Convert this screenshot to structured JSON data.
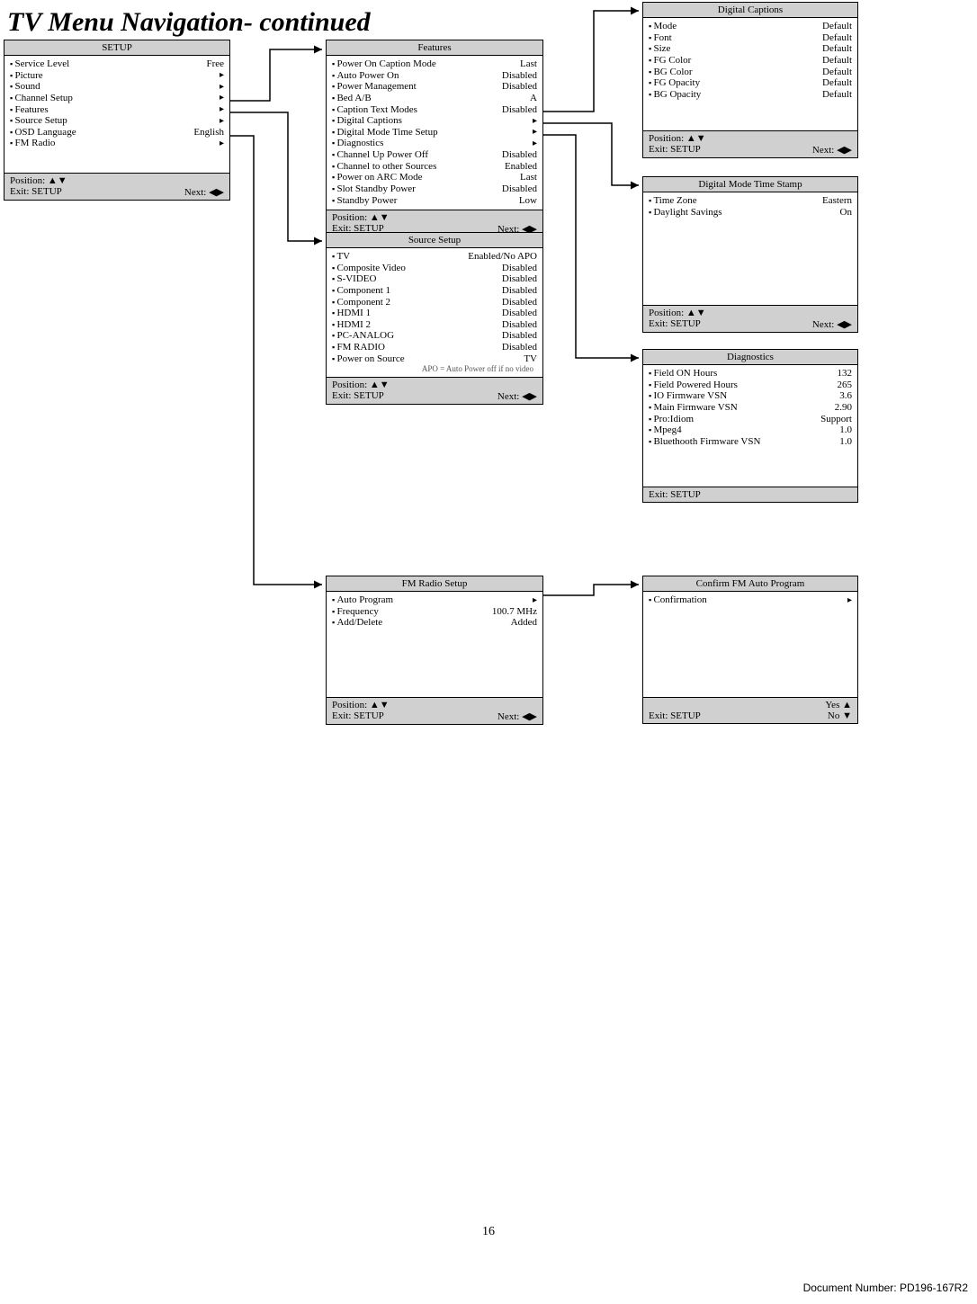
{
  "page": {
    "title": "TV Menu Navigation- continued",
    "number": "16",
    "docnum": "Document Number: PD196-167R2"
  },
  "footer_labels": {
    "position": "Position: ▲▼",
    "exit": "Exit: SETUP",
    "next": "Next: ◀▶",
    "yes": "Yes ▲",
    "no": "No ▼"
  },
  "setup": {
    "title": "SETUP",
    "rows": [
      {
        "label": "Service Level",
        "value": "Free"
      },
      {
        "label": "Picture",
        "value": "▸"
      },
      {
        "label": "Sound",
        "value": "▸"
      },
      {
        "label": "Channel Setup",
        "value": "▸"
      },
      {
        "label": "Features",
        "value": "▸"
      },
      {
        "label": "Source Setup",
        "value": "▸"
      },
      {
        "label": "OSD Language",
        "value": "English"
      },
      {
        "label": "FM Radio",
        "value": "▸"
      }
    ]
  },
  "features": {
    "title": "Features",
    "rows": [
      {
        "label": "Power On Caption Mode",
        "value": "Last"
      },
      {
        "label": "Auto Power On",
        "value": "Disabled"
      },
      {
        "label": "Power Management",
        "value": "Disabled"
      },
      {
        "label": "Bed A/B",
        "value": "A"
      },
      {
        "label": "Caption Text Modes",
        "value": "Disabled"
      },
      {
        "label": "Digital Captions",
        "value": "▸"
      },
      {
        "label": "Digital Mode Time Setup",
        "value": "▸"
      },
      {
        "label": "Diagnostics",
        "value": "▸"
      },
      {
        "label": "Channel Up Power Off",
        "value": "Disabled"
      },
      {
        "label": "Channel to other Sources",
        "value": "Enabled"
      },
      {
        "label": "Power on ARC Mode",
        "value": "Last"
      },
      {
        "label": "Slot Standby Power",
        "value": "Disabled"
      },
      {
        "label": "Standby Power",
        "value": "Low"
      }
    ]
  },
  "source_setup": {
    "title": "Source Setup",
    "rows": [
      {
        "label": "TV",
        "value": "Enabled/No APO"
      },
      {
        "label": "Composite Video",
        "value": "Disabled"
      },
      {
        "label": "S-VIDEO",
        "value": "Disabled"
      },
      {
        "label": "Component 1",
        "value": "Disabled"
      },
      {
        "label": "Component 2",
        "value": "Disabled"
      },
      {
        "label": "HDMI 1",
        "value": "Disabled"
      },
      {
        "label": "HDMI 2",
        "value": "Disabled"
      },
      {
        "label": "PC-ANALOG",
        "value": "Disabled"
      },
      {
        "label": "FM RADIO",
        "value": "Disabled"
      },
      {
        "label": "Power on Source",
        "value": "TV"
      }
    ],
    "note": "APO = Auto Power off if no video"
  },
  "fm_radio": {
    "title": "FM Radio Setup",
    "rows": [
      {
        "label": "Auto Program",
        "value": "▸"
      },
      {
        "label": "Frequency",
        "value": "100.7 MHz"
      },
      {
        "label": "Add/Delete",
        "value": "Added"
      }
    ]
  },
  "digital_captions": {
    "title": "Digital Captions",
    "rows": [
      {
        "label": "Mode",
        "value": "Default"
      },
      {
        "label": "Font",
        "value": "Default"
      },
      {
        "label": "Size",
        "value": "Default"
      },
      {
        "label": "FG Color",
        "value": "Default"
      },
      {
        "label": "BG Color",
        "value": "Default"
      },
      {
        "label": "FG Opacity",
        "value": "Default"
      },
      {
        "label": "BG Opacity",
        "value": "Default"
      }
    ]
  },
  "time_stamp": {
    "title": "Digital Mode Time Stamp",
    "rows": [
      {
        "label": "Time Zone",
        "value": "Eastern"
      },
      {
        "label": "Daylight Savings",
        "value": "On"
      }
    ]
  },
  "diagnostics": {
    "title": "Diagnostics",
    "rows": [
      {
        "label": "Field ON Hours",
        "value": "132"
      },
      {
        "label": "Field Powered Hours",
        "value": "265"
      },
      {
        "label": "IO Firmware VSN",
        "value": "3.6"
      },
      {
        "label": "Main Firmware VSN",
        "value": "2.90"
      },
      {
        "label": "Pro:Idiom",
        "value": "Support"
      },
      {
        "label": "Mpeg4",
        "value": "1.0"
      },
      {
        "label": "Bluethooth Firmware VSN",
        "value": "1.0"
      }
    ]
  },
  "confirm_fm": {
    "title": "Confirm FM Auto Program",
    "rows": [
      {
        "label": "Confirmation",
        "value": "▸"
      }
    ]
  }
}
